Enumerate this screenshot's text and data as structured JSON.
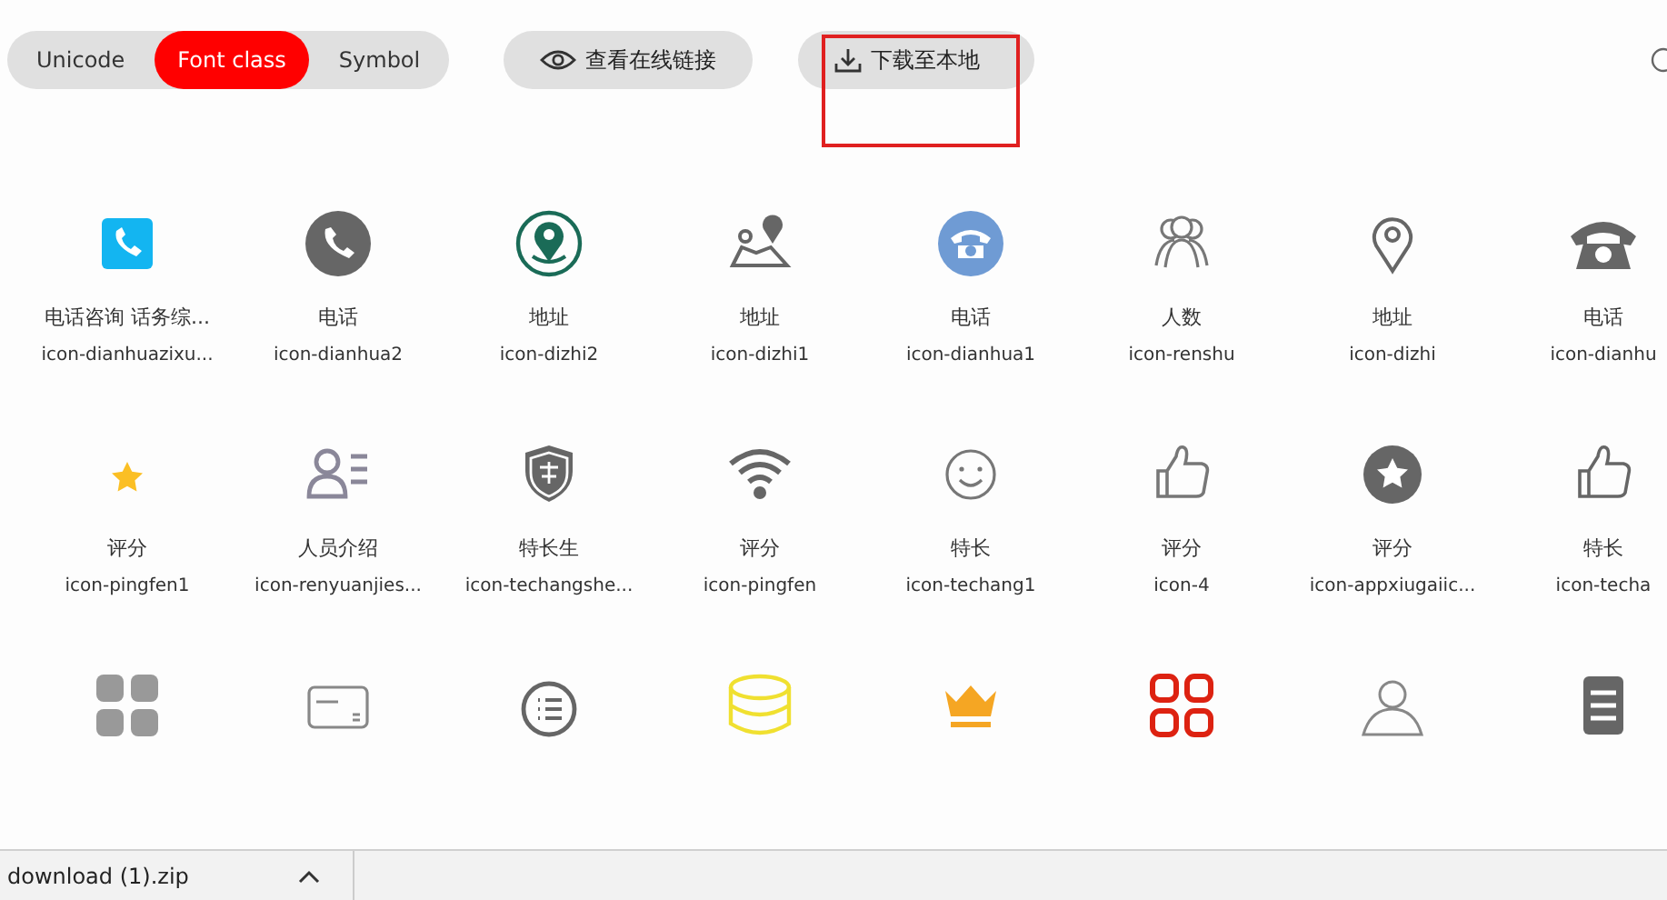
{
  "tabs": [
    {
      "label": "Unicode",
      "selected": false
    },
    {
      "label": "Font class",
      "selected": true
    },
    {
      "label": "Symbol",
      "selected": false
    }
  ],
  "actions": [
    {
      "kind": "eye",
      "label": "查看在线链接"
    },
    {
      "kind": "download",
      "label": "下载至本地"
    }
  ],
  "icons": [
    {
      "kind": "phone-square",
      "color": "#13b5f1",
      "name": "电话咨询 话务综...",
      "code": "icon-dianhuazixu..."
    },
    {
      "kind": "phone-circle",
      "color": "#666666",
      "name": "电话",
      "code": "icon-dianhua2"
    },
    {
      "kind": "pin-ring",
      "color": "#1a6b57",
      "name": "地址",
      "code": "icon-dizhi2"
    },
    {
      "kind": "map",
      "color": "#666666",
      "name": "地址",
      "code": "icon-dizhi1"
    },
    {
      "kind": "telephone-circle",
      "color": "#6f9bd4",
      "name": "电话",
      "code": "icon-dianhua1"
    },
    {
      "kind": "people",
      "color": "#777777",
      "name": "人数",
      "code": "icon-renshu"
    },
    {
      "kind": "pin",
      "color": "#666666",
      "name": "地址",
      "code": "icon-dizhi"
    },
    {
      "kind": "telephone",
      "color": "#666666",
      "name": "电话",
      "code": "icon-dianhu"
    },
    {
      "kind": "star",
      "color": "#fbbf24",
      "name": "评分",
      "code": "icon-pingfen1"
    },
    {
      "kind": "person-list",
      "color": "#8a8799",
      "name": "人员介绍",
      "code": "icon-renyuanjies..."
    },
    {
      "kind": "shield",
      "color": "#666666",
      "name": "特长生",
      "code": "icon-techangshe..."
    },
    {
      "kind": "wifi",
      "color": "#666666",
      "name": "评分",
      "code": "icon-pingfen"
    },
    {
      "kind": "smile",
      "color": "#777777",
      "name": "特长",
      "code": "icon-techang1"
    },
    {
      "kind": "thumb",
      "color": "#777777",
      "name": "评分",
      "code": "icon-4"
    },
    {
      "kind": "star-circle",
      "color": "#666666",
      "name": "评分",
      "code": "icon-appxiugaiic..."
    },
    {
      "kind": "thumb",
      "color": "#666666",
      "name": "特长",
      "code": "icon-techa"
    },
    {
      "kind": "grid",
      "color": "#999999"
    },
    {
      "kind": "card",
      "color": "#888888"
    },
    {
      "kind": "list-circle",
      "color": "#666666"
    },
    {
      "kind": "database",
      "color": "#f0e030"
    },
    {
      "kind": "crown",
      "color": "#f5a623"
    },
    {
      "kind": "grid-outline",
      "color": "#dd2211"
    },
    {
      "kind": "user",
      "color": "#888888"
    },
    {
      "kind": "menu-square",
      "color": "#666666"
    }
  ],
  "download_bar": {
    "file": "download (1).zip"
  }
}
